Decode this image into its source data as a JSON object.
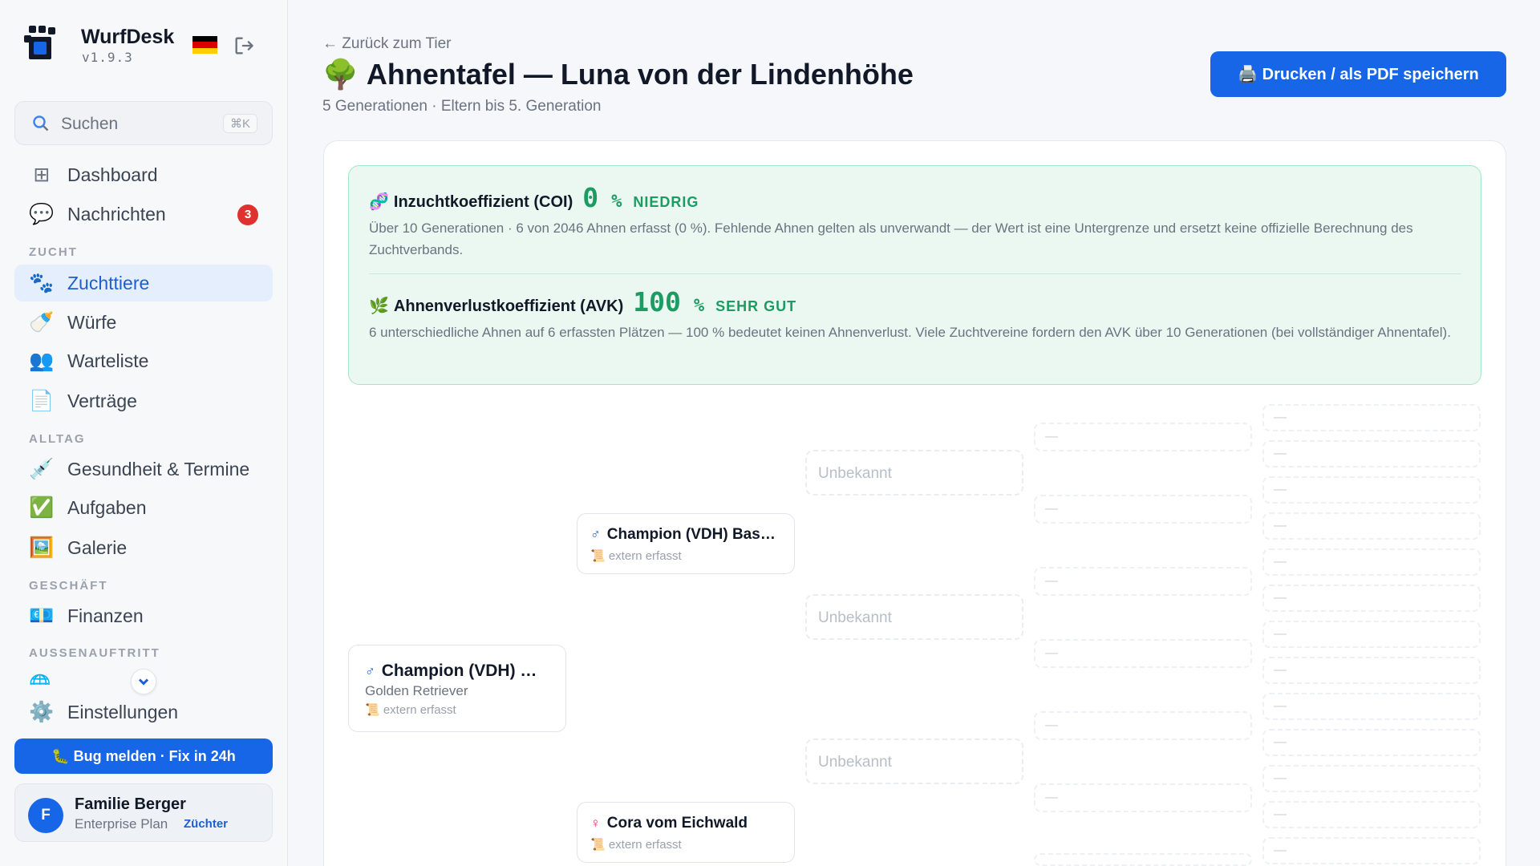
{
  "app": {
    "name": "WurfDesk",
    "version": "v1.9.3"
  },
  "search": {
    "label": "Suchen",
    "shortcut": "⌘K"
  },
  "nav": {
    "dashboard": "Dashboard",
    "messages": "Nachrichten",
    "messages_badge": "3",
    "section_zucht": "ZUCHT",
    "zuchttiere": "Zuchttiere",
    "wuerfe": "Würfe",
    "warteliste": "Warteliste",
    "vertraege": "Verträge",
    "section_alltag": "ALLTAG",
    "gesundheit": "Gesundheit & Termine",
    "aufgaben": "Aufgaben",
    "galerie": "Galerie",
    "section_geschaeft": "GESCHÄFT",
    "finanzen": "Finanzen",
    "section_aussen": "AUSSENAUFTRITT",
    "settings": "Einstellungen"
  },
  "bug_button": "🐛 Bug melden · Fix in 24h",
  "user": {
    "initial": "F",
    "name": "Familie Berger",
    "plan": "Enterprise Plan",
    "role": "Züchter"
  },
  "header": {
    "back": "← Zurück zum Tier",
    "title": "Ahnentafel — Luna von der Lindenhöhe",
    "subtitle": "5 Generationen · Eltern bis 5. Generation",
    "print": "🖨️ Drucken / als PDF speichern"
  },
  "coi": {
    "label": "Inzuchtkoeffizient (COI)",
    "value": "0",
    "unit": "%",
    "rating": "NIEDRIG",
    "description": "Über 10 Generationen · 6 von 2046 Ahnen erfasst (0 %). Fehlende Ahnen gelten als unverwandt — der Wert ist eine Untergrenze und ersetzt keine offizielle Berechnung des Zuchtverbands."
  },
  "avk": {
    "label": "Ahnenverlustkoeffizient (AVK)",
    "value": "100",
    "unit": "%",
    "rating": "SEHR GUT",
    "description": "6 unterschiedliche Ahnen auf 6 erfassten Plätzen — 100 % bedeutet keinen Ahnenverlust. Viele Zuchtvereine fordern den AVK über 10 Generationen (bei vollständiger Ahnentafel)."
  },
  "pedigree": {
    "sire": {
      "sex": "♂",
      "name": "Champion (VDH) …",
      "breed": "Golden Retriever",
      "source": "📜 extern erfasst"
    },
    "grandsire": {
      "sex": "♂",
      "name": "Champion (VDH) Bas…",
      "source": "📜 extern erfasst"
    },
    "granddam": {
      "sex": "♀",
      "name": "Cora vom Eichwald",
      "source": "📜 extern erfasst"
    },
    "unknown": "Unbekannt",
    "empty": "—"
  }
}
